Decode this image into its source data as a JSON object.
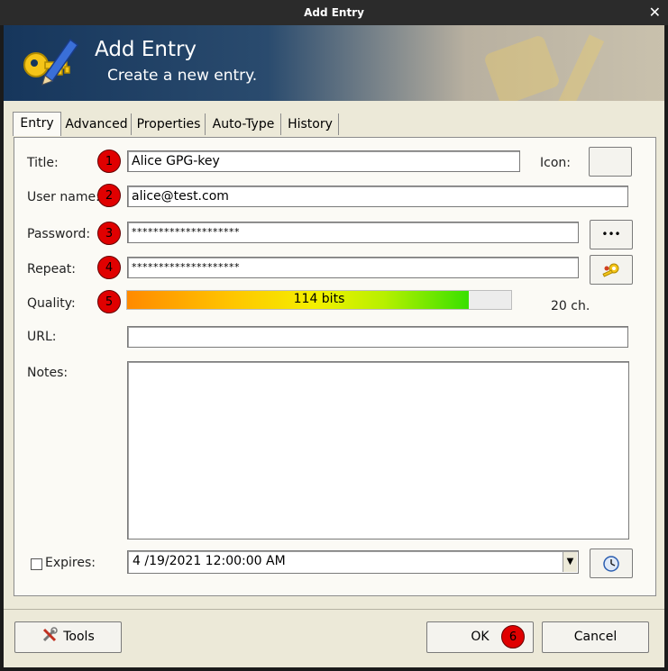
{
  "window": {
    "title": "Add Entry",
    "close_glyph": "✕"
  },
  "banner": {
    "title": "Add Entry",
    "subtitle": "Create a new entry."
  },
  "tabs": [
    "Entry",
    "Advanced",
    "Properties",
    "Auto-Type",
    "History"
  ],
  "form": {
    "title_label": "Title:",
    "title_value": "Alice GPG-key",
    "icon_label": "Icon:",
    "username_label": "User name:",
    "username_value": "alice@test.com",
    "password_label": "Password:",
    "password_value": "********************",
    "repeat_label": "Repeat:",
    "repeat_value": "********************",
    "quality_label": "Quality:",
    "quality_text": "114 bits",
    "quality_fraction": 0.89,
    "char_count": "20 ch.",
    "url_label": "URL:",
    "url_value": "",
    "notes_label": "Notes:",
    "notes_value": "",
    "expires_label": "Expires:",
    "expires_checked": false,
    "expires_value": "4 /19/2021 12:00:00 AM",
    "show_password_glyph": "•••"
  },
  "badges": [
    "1",
    "2",
    "3",
    "4",
    "5",
    "6"
  ],
  "footer": {
    "tools_label": "Tools",
    "ok_label": "OK",
    "cancel_label": "Cancel"
  },
  "icons": {
    "banner": "key-pencil-icon",
    "password_generator": "key-gear-icon",
    "expiry_picker": "clock-icon",
    "tools": "tools-icon",
    "dropdown": "chevron-down-icon"
  }
}
